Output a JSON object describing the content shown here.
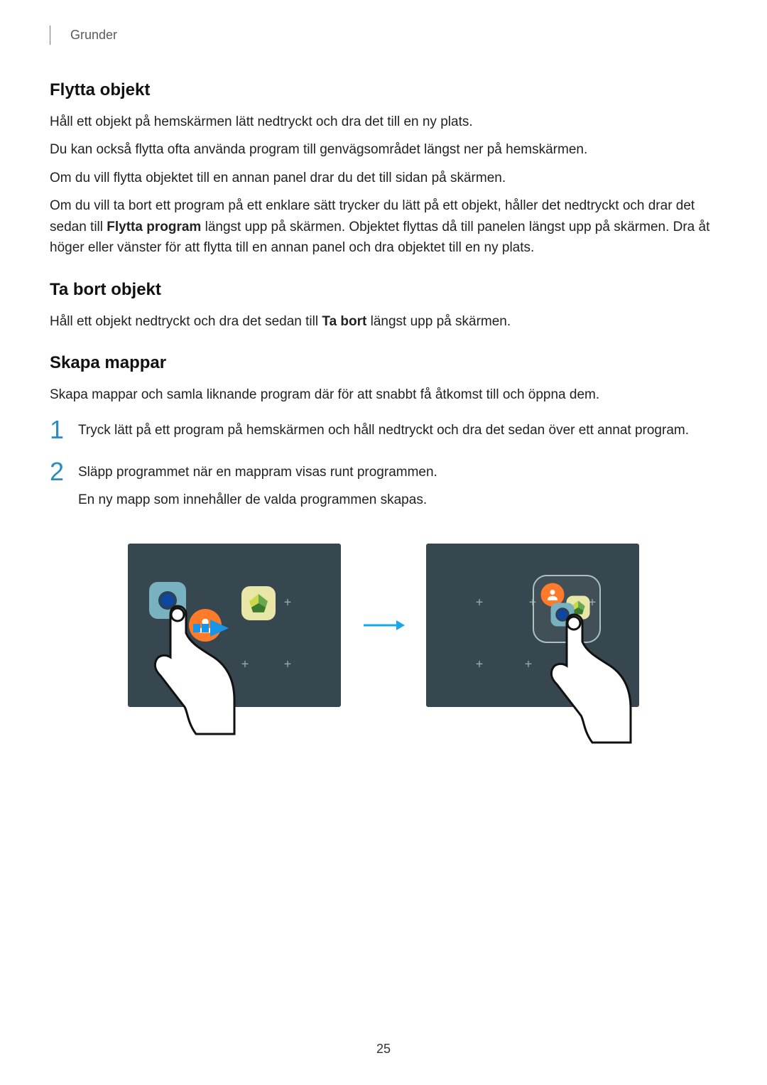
{
  "chapter": "Grunder",
  "sections": {
    "move": {
      "title": "Flytta objekt",
      "p1": "Håll ett objekt på hemskärmen lätt nedtryckt och dra det till en ny plats.",
      "p2": "Du kan också flytta ofta använda program till genvägsområdet längst ner på hemskärmen.",
      "p3": "Om du vill flytta objektet till en annan panel drar du det till sidan på skärmen.",
      "p4a": "Om du vill ta bort ett program på ett enklare sätt trycker du lätt på ett objekt, håller det nedtryckt och drar det sedan till ",
      "p4bold": "Flytta program",
      "p4b": " längst upp på skärmen. Objektet flyttas då till panelen längst upp på skärmen. Dra åt höger eller vänster för att flytta till en annan panel och dra objektet till en ny plats."
    },
    "remove": {
      "title": "Ta bort objekt",
      "p1a": "Håll ett objekt nedtryckt och dra det sedan till ",
      "p1bold": "Ta bort",
      "p1b": " längst upp på skärmen."
    },
    "folders": {
      "title": "Skapa mappar",
      "intro": "Skapa mappar och samla liknande program där för att snabbt få åtkomst till och öppna dem.",
      "step1_num": "1",
      "step1": "Tryck lätt på ett program på hemskärmen och håll nedtryckt och dra det sedan över ett annat program.",
      "step2_num": "2",
      "step2a": "Släpp programmet när en mappram visas runt programmen.",
      "step2b": "En ny mapp som innehåller de valda programmen skapas."
    }
  },
  "page_number": "25"
}
